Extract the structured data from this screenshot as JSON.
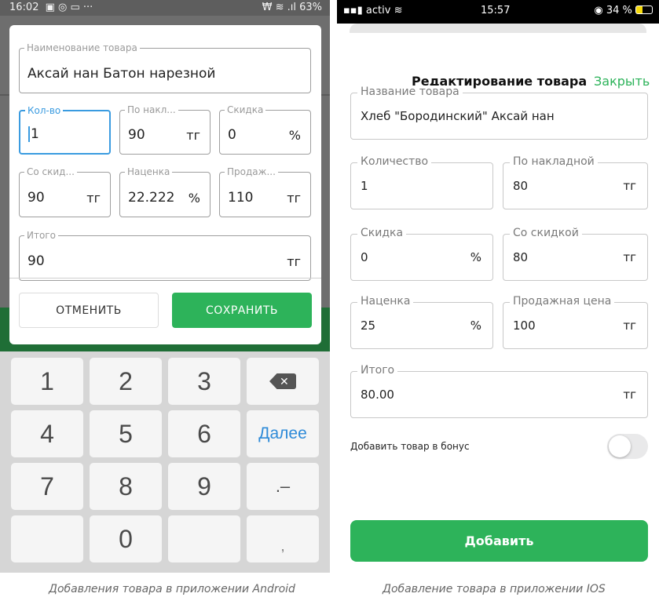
{
  "android": {
    "status_time": "16:02",
    "status_icons": "▣ ◎ ▭ ···",
    "status_right": "₩ ≋ .ıl 63%",
    "fields": {
      "name_label": "Наименование товара",
      "name_value": "Аксай нан Батон нарезной",
      "qty_label": "Кол-во",
      "qty_value": "1",
      "invoice_label": "По накл...",
      "invoice_value": "90",
      "invoice_unit": "тг",
      "discount_label": "Скидка",
      "discount_value": "0",
      "discount_unit": "%",
      "with_discount_label": "Со скид...",
      "with_discount_value": "90",
      "with_discount_unit": "тг",
      "markup_label": "Наценка",
      "markup_value": "22.222",
      "markup_unit": "%",
      "sale_label": "Продаж...",
      "sale_value": "110",
      "sale_unit": "тг",
      "total_label": "Итого",
      "total_value": "90",
      "total_unit": "тг"
    },
    "cancel_label": "ОТМЕНИТЬ",
    "save_label": "СОХРАНИТЬ",
    "keyboard": {
      "k1": "1",
      "k2": "2",
      "k3": "3",
      "backspace": "✕",
      "k4": "4",
      "k5": "5",
      "k6": "6",
      "next": "Далее",
      "k7": "7",
      "k8": "8",
      "k9": "9",
      "dot_dash": ".–",
      "k0": "0",
      "comma": ","
    }
  },
  "ios": {
    "carrier": "activ",
    "time": "15:57",
    "battery": "34 %",
    "title": "Редактирование товара",
    "close_label": "Закрыть",
    "fields": {
      "name_label": "Название товара",
      "name_value": "Хлеб \"Бородинский\" Аксай нан",
      "qty_label": "Количество",
      "qty_value": "1",
      "invoice_label": "По накладной",
      "invoice_value": "80",
      "invoice_unit": "тг",
      "discount_label": "Скидка",
      "discount_value": "0",
      "discount_unit": "%",
      "with_discount_label": "Со скидкой",
      "with_discount_value": "80",
      "with_discount_unit": "тг",
      "markup_label": "Наценка",
      "markup_value": "25",
      "markup_unit": "%",
      "sale_label": "Продажная цена",
      "sale_value": "100",
      "sale_unit": "тг",
      "total_label": "Итого",
      "total_value": "80.00",
      "total_unit": "тг"
    },
    "bonus_label": "Добавить товар в бонус",
    "bonus_toggle_on": false,
    "add_label": "Добавить"
  },
  "captions": {
    "android": "Добавления товара в приложении Android",
    "ios": "Добавление товара в приложении IOS"
  },
  "colors": {
    "accent_green": "#2db35a",
    "focus_blue": "#3a9be0"
  }
}
